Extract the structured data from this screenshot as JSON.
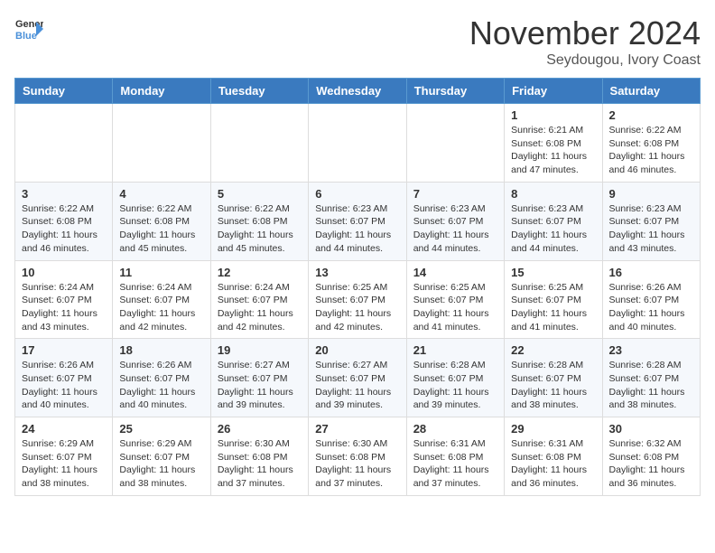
{
  "header": {
    "logo_line1": "General",
    "logo_line2": "Blue",
    "month": "November 2024",
    "location": "Seydougou, Ivory Coast"
  },
  "weekdays": [
    "Sunday",
    "Monday",
    "Tuesday",
    "Wednesday",
    "Thursday",
    "Friday",
    "Saturday"
  ],
  "rows": [
    [
      {
        "day": "",
        "info": ""
      },
      {
        "day": "",
        "info": ""
      },
      {
        "day": "",
        "info": ""
      },
      {
        "day": "",
        "info": ""
      },
      {
        "day": "",
        "info": ""
      },
      {
        "day": "1",
        "info": "Sunrise: 6:21 AM\nSunset: 6:08 PM\nDaylight: 11 hours and 47 minutes."
      },
      {
        "day": "2",
        "info": "Sunrise: 6:22 AM\nSunset: 6:08 PM\nDaylight: 11 hours and 46 minutes."
      }
    ],
    [
      {
        "day": "3",
        "info": "Sunrise: 6:22 AM\nSunset: 6:08 PM\nDaylight: 11 hours and 46 minutes."
      },
      {
        "day": "4",
        "info": "Sunrise: 6:22 AM\nSunset: 6:08 PM\nDaylight: 11 hours and 45 minutes."
      },
      {
        "day": "5",
        "info": "Sunrise: 6:22 AM\nSunset: 6:08 PM\nDaylight: 11 hours and 45 minutes."
      },
      {
        "day": "6",
        "info": "Sunrise: 6:23 AM\nSunset: 6:07 PM\nDaylight: 11 hours and 44 minutes."
      },
      {
        "day": "7",
        "info": "Sunrise: 6:23 AM\nSunset: 6:07 PM\nDaylight: 11 hours and 44 minutes."
      },
      {
        "day": "8",
        "info": "Sunrise: 6:23 AM\nSunset: 6:07 PM\nDaylight: 11 hours and 44 minutes."
      },
      {
        "day": "9",
        "info": "Sunrise: 6:23 AM\nSunset: 6:07 PM\nDaylight: 11 hours and 43 minutes."
      }
    ],
    [
      {
        "day": "10",
        "info": "Sunrise: 6:24 AM\nSunset: 6:07 PM\nDaylight: 11 hours and 43 minutes."
      },
      {
        "day": "11",
        "info": "Sunrise: 6:24 AM\nSunset: 6:07 PM\nDaylight: 11 hours and 42 minutes."
      },
      {
        "day": "12",
        "info": "Sunrise: 6:24 AM\nSunset: 6:07 PM\nDaylight: 11 hours and 42 minutes."
      },
      {
        "day": "13",
        "info": "Sunrise: 6:25 AM\nSunset: 6:07 PM\nDaylight: 11 hours and 42 minutes."
      },
      {
        "day": "14",
        "info": "Sunrise: 6:25 AM\nSunset: 6:07 PM\nDaylight: 11 hours and 41 minutes."
      },
      {
        "day": "15",
        "info": "Sunrise: 6:25 AM\nSunset: 6:07 PM\nDaylight: 11 hours and 41 minutes."
      },
      {
        "day": "16",
        "info": "Sunrise: 6:26 AM\nSunset: 6:07 PM\nDaylight: 11 hours and 40 minutes."
      }
    ],
    [
      {
        "day": "17",
        "info": "Sunrise: 6:26 AM\nSunset: 6:07 PM\nDaylight: 11 hours and 40 minutes."
      },
      {
        "day": "18",
        "info": "Sunrise: 6:26 AM\nSunset: 6:07 PM\nDaylight: 11 hours and 40 minutes."
      },
      {
        "day": "19",
        "info": "Sunrise: 6:27 AM\nSunset: 6:07 PM\nDaylight: 11 hours and 39 minutes."
      },
      {
        "day": "20",
        "info": "Sunrise: 6:27 AM\nSunset: 6:07 PM\nDaylight: 11 hours and 39 minutes."
      },
      {
        "day": "21",
        "info": "Sunrise: 6:28 AM\nSunset: 6:07 PM\nDaylight: 11 hours and 39 minutes."
      },
      {
        "day": "22",
        "info": "Sunrise: 6:28 AM\nSunset: 6:07 PM\nDaylight: 11 hours and 38 minutes."
      },
      {
        "day": "23",
        "info": "Sunrise: 6:28 AM\nSunset: 6:07 PM\nDaylight: 11 hours and 38 minutes."
      }
    ],
    [
      {
        "day": "24",
        "info": "Sunrise: 6:29 AM\nSunset: 6:07 PM\nDaylight: 11 hours and 38 minutes."
      },
      {
        "day": "25",
        "info": "Sunrise: 6:29 AM\nSunset: 6:07 PM\nDaylight: 11 hours and 38 minutes."
      },
      {
        "day": "26",
        "info": "Sunrise: 6:30 AM\nSunset: 6:08 PM\nDaylight: 11 hours and 37 minutes."
      },
      {
        "day": "27",
        "info": "Sunrise: 6:30 AM\nSunset: 6:08 PM\nDaylight: 11 hours and 37 minutes."
      },
      {
        "day": "28",
        "info": "Sunrise: 6:31 AM\nSunset: 6:08 PM\nDaylight: 11 hours and 37 minutes."
      },
      {
        "day": "29",
        "info": "Sunrise: 6:31 AM\nSunset: 6:08 PM\nDaylight: 11 hours and 36 minutes."
      },
      {
        "day": "30",
        "info": "Sunrise: 6:32 AM\nSunset: 6:08 PM\nDaylight: 11 hours and 36 minutes."
      }
    ]
  ]
}
